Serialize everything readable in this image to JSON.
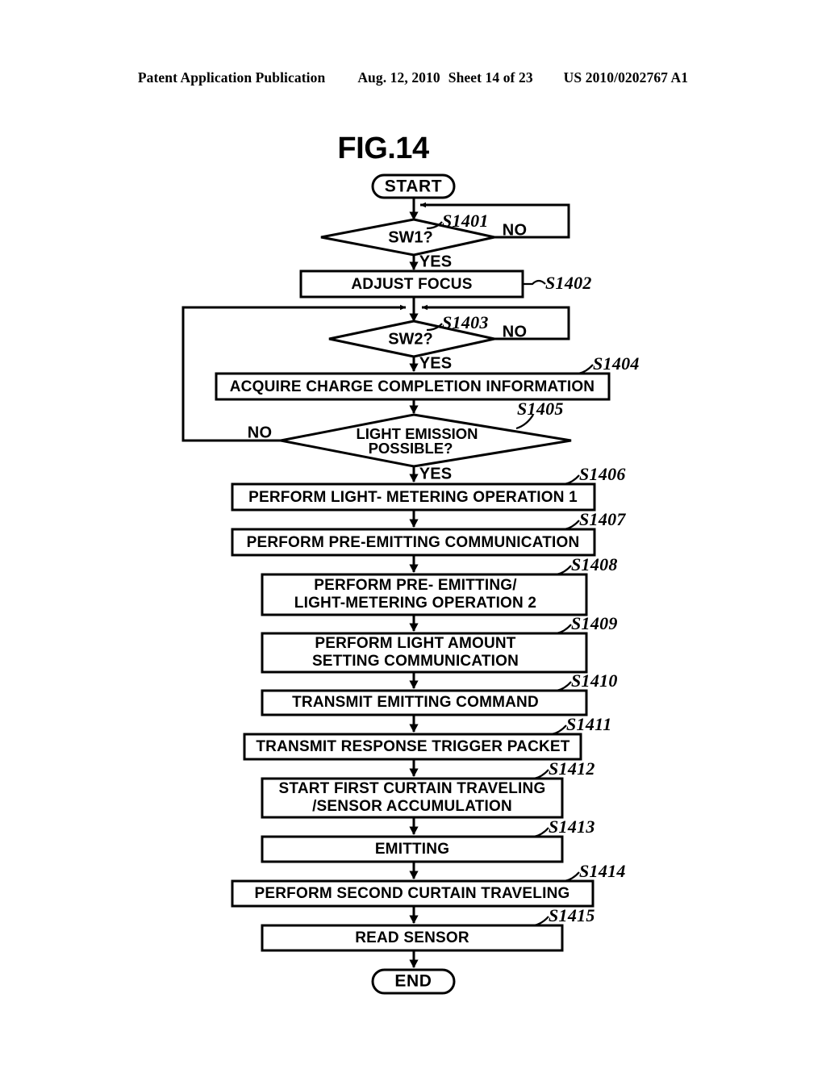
{
  "header": {
    "publication": "Patent Application Publication",
    "date": "Aug. 12, 2010",
    "sheet": "Sheet 14 of 23",
    "patent_number": "US 2010/0202767 A1"
  },
  "figure": {
    "title": "FIG.14"
  },
  "flowchart": {
    "type": "flowchart",
    "start_label": "START",
    "end_label": "END",
    "branch_yes": "YES",
    "branch_no": "NO",
    "nodes": [
      {
        "id": "start",
        "step": "",
        "shape": "terminator",
        "text": "START"
      },
      {
        "id": "S1401",
        "step": "S1401",
        "shape": "decision",
        "text": "SW1?"
      },
      {
        "id": "S1402",
        "step": "S1402",
        "shape": "process",
        "text": "ADJUST FOCUS"
      },
      {
        "id": "S1403",
        "step": "S1403",
        "shape": "decision",
        "text": "SW2?"
      },
      {
        "id": "S1404",
        "step": "S1404",
        "shape": "process",
        "text": "ACQUIRE CHARGE COMPLETION INFORMATION"
      },
      {
        "id": "S1405",
        "step": "S1405",
        "shape": "decision",
        "text_line1": "LIGHT EMISSION",
        "text_line2": "POSSIBLE?"
      },
      {
        "id": "S1406",
        "step": "S1406",
        "shape": "process",
        "text": "PERFORM LIGHT- METERING OPERATION 1"
      },
      {
        "id": "S1407",
        "step": "S1407",
        "shape": "process",
        "text": "PERFORM PRE-EMITTING COMMUNICATION"
      },
      {
        "id": "S1408",
        "step": "S1408",
        "shape": "process",
        "text_line1": "PERFORM PRE- EMITTING/",
        "text_line2": "LIGHT-METERING OPERATION 2"
      },
      {
        "id": "S1409",
        "step": "S1409",
        "shape": "process",
        "text_line1": "PERFORM LIGHT AMOUNT",
        "text_line2": "SETTING COMMUNICATION"
      },
      {
        "id": "S1410",
        "step": "S1410",
        "shape": "process",
        "text": "TRANSMIT EMITTING COMMAND"
      },
      {
        "id": "S1411",
        "step": "S1411",
        "shape": "process",
        "text": "TRANSMIT RESPONSE TRIGGER PACKET"
      },
      {
        "id": "S1412",
        "step": "S1412",
        "shape": "process",
        "text_line1": "START FIRST CURTAIN TRAVELING",
        "text_line2": "/SENSOR ACCUMULATION"
      },
      {
        "id": "S1413",
        "step": "S1413",
        "shape": "process",
        "text": "EMITTING"
      },
      {
        "id": "S1414",
        "step": "S1414",
        "shape": "process",
        "text": "PERFORM SECOND CURTAIN TRAVELING"
      },
      {
        "id": "S1415",
        "step": "S1415",
        "shape": "process",
        "text": "READ SENSOR"
      },
      {
        "id": "end",
        "step": "",
        "shape": "terminator",
        "text": "END"
      }
    ],
    "edges": [
      {
        "from": "start",
        "to": "S1401",
        "label": ""
      },
      {
        "from": "S1401",
        "to": "S1402",
        "label": "YES"
      },
      {
        "from": "S1401",
        "to": "S1401",
        "label": "NO"
      },
      {
        "from": "S1402",
        "to": "S1403",
        "label": ""
      },
      {
        "from": "S1403",
        "to": "S1404",
        "label": "YES"
      },
      {
        "from": "S1403",
        "to": "S1403",
        "label": "NO"
      },
      {
        "from": "S1404",
        "to": "S1405",
        "label": ""
      },
      {
        "from": "S1405",
        "to": "S1406",
        "label": "YES"
      },
      {
        "from": "S1405",
        "to": "S1403",
        "label": "NO"
      },
      {
        "from": "S1406",
        "to": "S1407",
        "label": ""
      },
      {
        "from": "S1407",
        "to": "S1408",
        "label": ""
      },
      {
        "from": "S1408",
        "to": "S1409",
        "label": ""
      },
      {
        "from": "S1409",
        "to": "S1410",
        "label": ""
      },
      {
        "from": "S1410",
        "to": "S1411",
        "label": ""
      },
      {
        "from": "S1411",
        "to": "S1412",
        "label": ""
      },
      {
        "from": "S1412",
        "to": "S1413",
        "label": ""
      },
      {
        "from": "S1413",
        "to": "S1414",
        "label": ""
      },
      {
        "from": "S1414",
        "to": "S1415",
        "label": ""
      },
      {
        "from": "S1415",
        "to": "end",
        "label": ""
      }
    ],
    "labels": {
      "sw1_no": "NO",
      "sw1_yes": "YES",
      "sw2_no": "NO",
      "sw2_yes": "YES",
      "emission_no": "NO",
      "emission_yes": "YES"
    },
    "step_ids": {
      "s1401": "S1401",
      "s1402": "S1402",
      "s1403": "S1403",
      "s1404": "S1404",
      "s1405": "S1405",
      "s1406": "S1406",
      "s1407": "S1407",
      "s1408": "S1408",
      "s1409": "S1409",
      "s1410": "S1410",
      "s1411": "S1411",
      "s1412": "S1412",
      "s1413": "S1413",
      "s1414": "S1414",
      "s1415": "S1415"
    },
    "text": {
      "start": "START",
      "sw1": "SW1?",
      "adjust_focus": "ADJUST FOCUS",
      "sw2": "SW2?",
      "acquire_charge": "ACQUIRE CHARGE COMPLETION INFORMATION",
      "light_emission_l1": "LIGHT EMISSION",
      "light_emission_l2": "POSSIBLE?",
      "light_metering_1": "PERFORM LIGHT- METERING OPERATION 1",
      "pre_emitting_comm": "PERFORM PRE-EMITTING COMMUNICATION",
      "pre_emit_meter_l1": "PERFORM PRE- EMITTING/",
      "pre_emit_meter_l2": "LIGHT-METERING OPERATION 2",
      "light_amount_l1": "PERFORM LIGHT AMOUNT",
      "light_amount_l2": "SETTING COMMUNICATION",
      "transmit_emitting": "TRANSMIT EMITTING COMMAND",
      "transmit_response": "TRANSMIT RESPONSE TRIGGER PACKET",
      "first_curtain_l1": "START FIRST CURTAIN TRAVELING",
      "first_curtain_l2": "/SENSOR ACCUMULATION",
      "emitting": "EMITTING",
      "second_curtain": "PERFORM SECOND CURTAIN TRAVELING",
      "read_sensor": "READ SENSOR",
      "end": "END"
    }
  },
  "colors": {
    "ink": "#000000",
    "paper": "#ffffff"
  }
}
